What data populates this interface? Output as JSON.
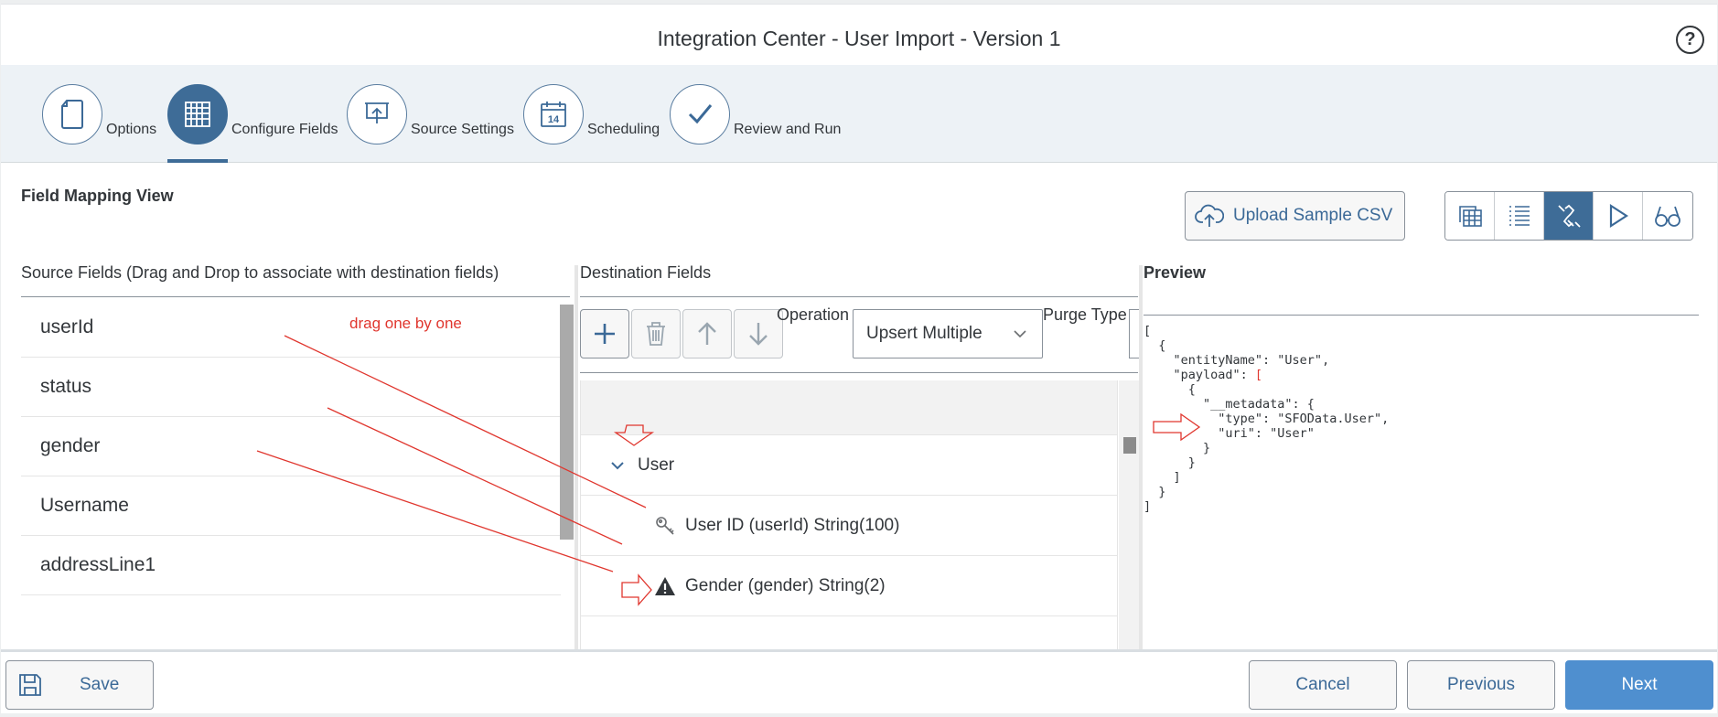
{
  "header": {
    "title": "Integration Center - User Import - Version 1",
    "help_icon": "?"
  },
  "wizard": {
    "steps": [
      {
        "label": "Options",
        "icon": "document-icon"
      },
      {
        "label": "Configure Fields",
        "icon": "table-grid-icon",
        "active": true
      },
      {
        "label": "Source Settings",
        "icon": "upload-presentation-icon"
      },
      {
        "label": "Scheduling",
        "icon": "calendar-icon",
        "day": "14"
      },
      {
        "label": "Review and Run",
        "icon": "checkmark-icon"
      }
    ]
  },
  "main": {
    "section_title": "Field Mapping View",
    "upload_label": "Upload Sample CSV",
    "view_buttons": [
      "table-view-icon",
      "list-view-icon",
      "mapping-view-icon",
      "run-icon",
      "glasses-icon"
    ],
    "active_view": "mapping-view-icon"
  },
  "source": {
    "header": "Source Fields (Drag and Drop to associate with destination fields)",
    "fields": [
      "userId",
      "status",
      "gender",
      "Username",
      "addressLine1"
    ]
  },
  "destination": {
    "header": "Destination Fields",
    "operation_label": "Operation",
    "operation_value": "Upsert Multiple",
    "purge_label": "Purge Type",
    "tree": [
      {
        "label": "User",
        "icon": "chevron-down-icon"
      },
      {
        "label": "User ID (userId) String(100)",
        "icon": "key-icon"
      },
      {
        "label": "Gender (gender) String(2)",
        "icon": "warning-icon"
      }
    ]
  },
  "preview": {
    "header": "Preview",
    "lines": [
      "[",
      "  {",
      "    \"entityName\": \"User\",",
      "    \"payload\": [",
      "      {",
      "        \"__metadata\": {",
      "          \"type\": \"SFOData.User\",",
      "          \"uri\": \"User\"",
      "        }",
      "      }",
      "    ]",
      "  }",
      "]"
    ]
  },
  "annotation": {
    "text": "drag one by one",
    "color": "#e0362e"
  },
  "footer": {
    "save_label": "Save",
    "cancel_label": "Cancel",
    "previous_label": "Previous",
    "next_label": "Next"
  },
  "colors": {
    "accent": "#3e6c97",
    "next": "#4f8fcf",
    "annotation": "#e0362e"
  }
}
